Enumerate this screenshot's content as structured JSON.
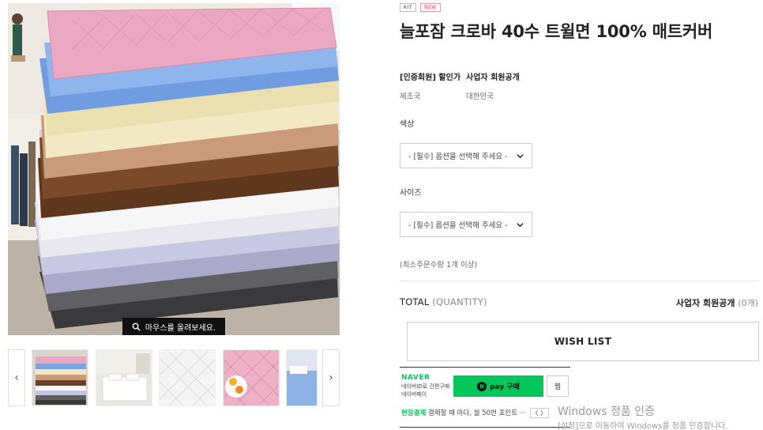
{
  "product": {
    "badges": [
      "KIT",
      "NEW"
    ],
    "title": "늘포잠 크로바 40수 트윌면 100% 매트커버"
  },
  "image": {
    "hover_hint": "마우스를 올려보세요."
  },
  "thumbnails": {
    "prev_label": "‹",
    "next_label": "›"
  },
  "info": {
    "price_label": "[인증회원] 할인가",
    "price_value": "사업자 회원공개",
    "origin_label": "제조국",
    "origin_value": "대한민국"
  },
  "options": {
    "color_title": "색상",
    "color_placeholder": "- [필수] 옵션을 선택해 주세요 -",
    "size_title": "사이즈",
    "size_placeholder": "- [필수] 옵션을 선택해 주세요 -",
    "min_qty": "(최소주문수량 1개 이상)"
  },
  "total": {
    "label": "TOTAL",
    "quantity_label": "(QUANTITY)",
    "value": "사업자 회원공개",
    "count": "(0개)"
  },
  "wishlist_label": "WISH LIST",
  "naver": {
    "logo": "NAVER",
    "sub_line1": "네이버ID로 간편구매",
    "sub_line2": "네이버페이",
    "pay_label": "pay 구매",
    "pay_n": "N",
    "zzim_label": "찜",
    "foot_green": "현장결제",
    "foot_text": "결제할 때 마다, 월 50번 포인트 ···",
    "foot_arrow": "〈 〉"
  },
  "watermark": {
    "line1": "Windows 정품 인증",
    "line2": "[설정]으로 이동하여 Windows를 정품 인증합니다."
  },
  "colors": {
    "naver_green": "#03c75a",
    "quilt_pink": "#e9a6bf",
    "quilt_blue": "#6d9be0",
    "quilt_cream": "#f2e7c2",
    "quilt_brown": "#6a3e22"
  }
}
